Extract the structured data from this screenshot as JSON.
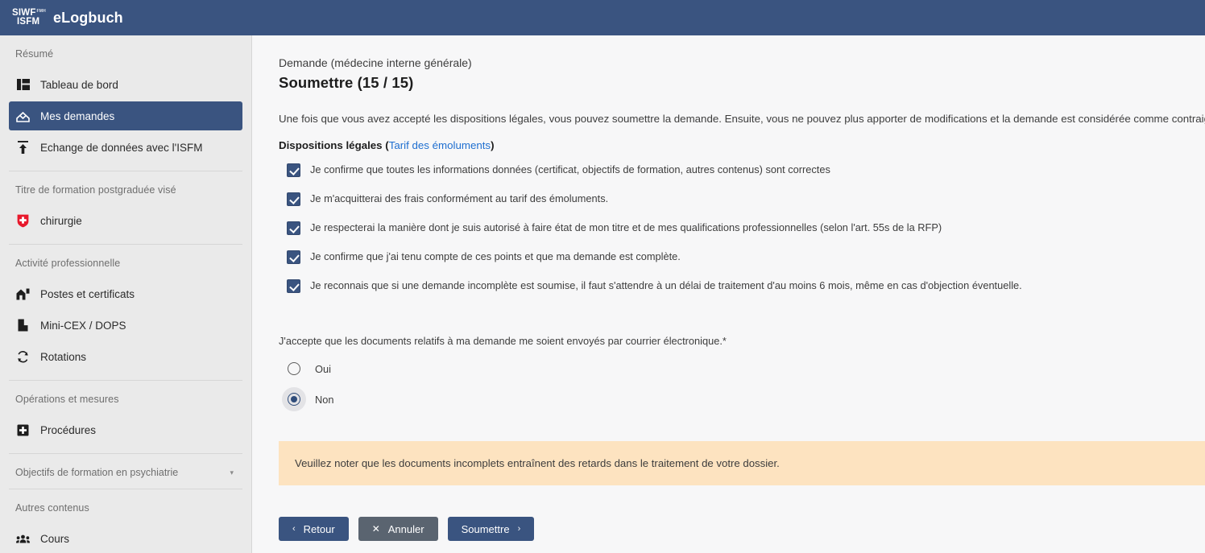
{
  "header": {
    "logo_line1": "SIWF",
    "logo_sup": "FMH",
    "logo_line2": "ISFM",
    "app_title": "eLogbuch"
  },
  "sidebar": {
    "groups": [
      {
        "heading": "Résumé",
        "items": [
          {
            "label": "Tableau de bord",
            "icon": "dashboard-icon",
            "active": false
          },
          {
            "label": "Mes demandes",
            "icon": "inbox-tray-icon",
            "active": true
          },
          {
            "label": "Echange de données avec l'ISFM",
            "icon": "upload-arrow-icon",
            "active": false
          }
        ]
      },
      {
        "heading": "Titre de formation postgraduée visé",
        "items": [
          {
            "label": "chirurgie",
            "icon": "swiss-shield-icon",
            "active": false
          }
        ]
      },
      {
        "heading": "Activité professionnelle",
        "items": [
          {
            "label": "Postes et certificats",
            "icon": "hospital-building-icon",
            "active": false
          },
          {
            "label": "Mini-CEX / DOPS",
            "icon": "book-icon",
            "active": false
          },
          {
            "label": "Rotations",
            "icon": "refresh-rotate-icon",
            "active": false
          }
        ]
      },
      {
        "heading": "Opérations et mesures",
        "items": [
          {
            "label": "Procédures",
            "icon": "plus-square-icon",
            "active": false
          }
        ]
      }
    ],
    "collapsible": {
      "label": "Objectifs de formation en psychiatrie",
      "caret": "▾"
    },
    "last_group": {
      "heading": "Autres contenus",
      "items": [
        {
          "label": "Cours",
          "icon": "people-group-icon",
          "active": false
        }
      ]
    }
  },
  "main": {
    "breadcrumb": "Demande (médecine interne générale)",
    "title": "Soumettre (15 / 15)",
    "intro": "Une fois que vous avez accepté les dispositions légales, vous pouvez soumettre la demande. Ensuite, vous ne pouvez plus apporter de modifications et la demande est considérée comme contraignante.",
    "legal_heading": "Dispositions légales",
    "legal_link": "Tarif des émoluments",
    "legal_paren_open": " (",
    "legal_paren_close": ")",
    "checkboxes": [
      {
        "label": "Je confirme que toutes les informations données (certificat, objectifs de formation, autres contenus) sont correctes",
        "checked": true
      },
      {
        "label": "Je m'acquitterai des frais conformément au tarif des émoluments.",
        "checked": true
      },
      {
        "label": "Je respecterai la manière dont je suis autorisé à faire état de mon titre et de mes qualifications professionnelles (selon l'art. 55s de la RFP)",
        "checked": true
      },
      {
        "label": "Je confirme que j'ai tenu compte de ces points et que ma demande est complète.",
        "checked": true
      },
      {
        "label": "Je reconnais que si une demande incomplète est soumise, il faut s'attendre à un délai de traitement d'au moins 6 mois, même en cas d'objection éventuelle.",
        "checked": true
      }
    ],
    "consent_question": "J'accepte que les documents relatifs à ma demande me soient envoyés par courrier électronique.*",
    "radios": [
      {
        "label": "Oui",
        "checked": false
      },
      {
        "label": "Non",
        "checked": true
      }
    ],
    "alert_text": "Veuillez noter que les documents incomplets entraînent des retards dans le traitement de votre dossier.",
    "buttons": {
      "back": {
        "label": "Retour",
        "chevron": "‹"
      },
      "cancel": {
        "label": "Annuler",
        "x": "✕"
      },
      "submit": {
        "label": "Soumettre",
        "chevron": "›"
      }
    }
  },
  "colors": {
    "brand_blue": "#3a5480",
    "sidebar_bg": "#eaeaea",
    "alert_bg": "#fde3c0",
    "link_blue": "#1f6fd0",
    "cancel_gray": "#5a6470",
    "swiss_red": "#e8192c"
  }
}
